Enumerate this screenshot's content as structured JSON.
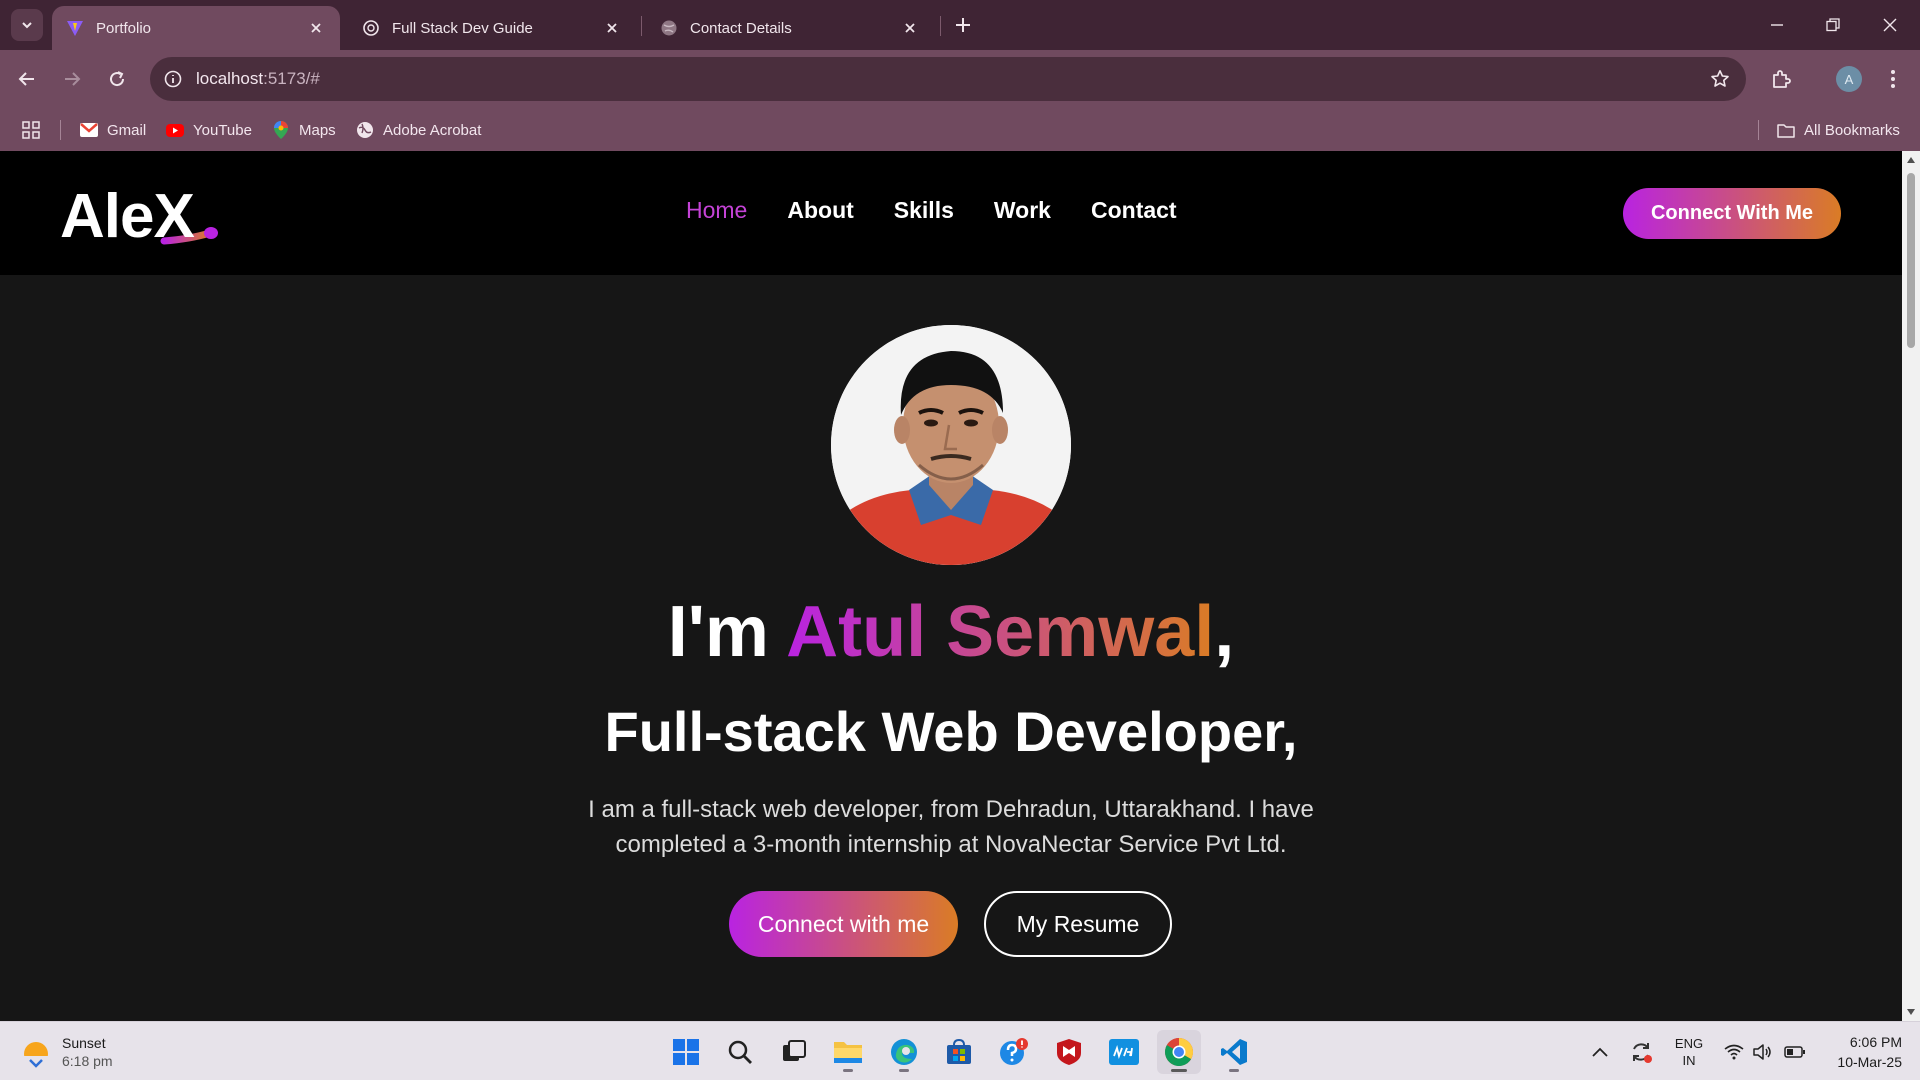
{
  "browser": {
    "tabs": [
      {
        "title": "Portfolio",
        "active": true
      },
      {
        "title": "Full Stack Dev Guide",
        "active": false
      },
      {
        "title": "Contact Details",
        "active": false
      }
    ],
    "url_host": "localhost",
    "url_rest": ":5173/#",
    "profile_initial": "A",
    "bookmarks": [
      "Gmail",
      "YouTube",
      "Maps",
      "Adobe Acrobat"
    ],
    "all_bookmarks": "All Bookmarks"
  },
  "site": {
    "logo_text": "AleX",
    "nav": [
      "Home",
      "About",
      "Skills",
      "Work",
      "Contact"
    ],
    "connect_top": "Connect With Me",
    "hero": {
      "prefix": "I'm ",
      "name": "Atul Semwal",
      "suffix": ",",
      "subtitle": "Full-stack Web Developer,",
      "description": "I am a full-stack web developer, from Dehradun, Uttarakhand. I have completed a 3-month internship at NovaNectar Service Pvt Ltd.",
      "btn_connect": "Connect with me",
      "btn_resume": "My Resume"
    }
  },
  "taskbar": {
    "weather_title": "Sunset",
    "weather_time": "6:18 pm",
    "lang_1": "ENG",
    "lang_2": "IN",
    "time": "6:06 PM",
    "date": "10-Mar-25"
  },
  "colors": {
    "accent_purple": "#b923e1",
    "accent_orange": "#da7c25",
    "nav_active": "#c443d6",
    "chrome_bg": "#704a5f"
  }
}
